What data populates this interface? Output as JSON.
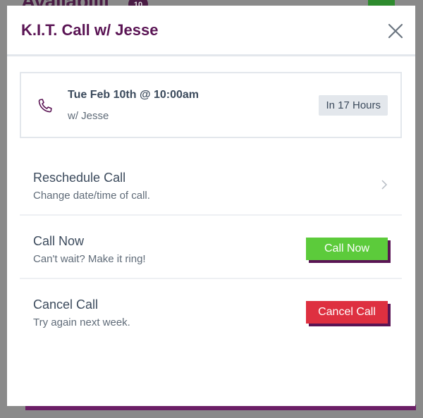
{
  "background": {
    "title_fragment": "Availabilit",
    "badge_count": "10"
  },
  "modal": {
    "title": "K.I.T. Call w/ Jesse",
    "close_icon": "close-icon"
  },
  "summary": {
    "icon": "phone-icon",
    "datetime": "Tue Feb 10th @ 10:00am",
    "with": "w/ Jesse",
    "relative_time": "In 17 Hours"
  },
  "options": {
    "reschedule": {
      "title": "Reschedule Call",
      "subtitle": "Change date/time of call.",
      "icon": "chevron-right-icon"
    },
    "call_now": {
      "title": "Call Now",
      "subtitle": "Can't wait? Make it ring!",
      "button_label": "Call Now"
    },
    "cancel": {
      "title": "Cancel Call",
      "subtitle": "Try again next week.",
      "button_label": "Cancel Call"
    }
  },
  "colors": {
    "brand_purple": "#5a1454",
    "call_green": "#5ccb3b",
    "cancel_red": "#de3040",
    "overlay_gray": "#888888"
  }
}
